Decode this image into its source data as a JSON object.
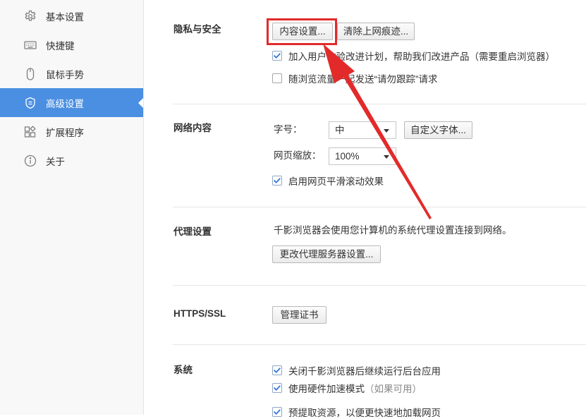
{
  "colors": {
    "accent": "#4a8fe2",
    "annotation": "#e32a2a",
    "check": "#3a7bd5"
  },
  "sidebar": {
    "items": [
      {
        "label": "基本设置",
        "icon": "gear-icon",
        "active": false
      },
      {
        "label": "快捷键",
        "icon": "keyboard-icon",
        "active": false
      },
      {
        "label": "鼠标手势",
        "icon": "mouse-icon",
        "active": false
      },
      {
        "label": "高级设置",
        "icon": "shield-icon",
        "active": true
      },
      {
        "label": "扩展程序",
        "icon": "extensions-icon",
        "active": false
      },
      {
        "label": "关于",
        "icon": "info-icon",
        "active": false
      }
    ]
  },
  "privacy": {
    "title": "隐私与安全",
    "content_settings_button": "内容设置...",
    "clear_history_button": "清除上网痕迹...",
    "checkboxes": [
      {
        "label": "加入用户体验改进计划，帮助我们改进产品（需要重启浏览器）",
        "checked": true
      },
      {
        "label": "随浏览流量一起发送“请勿跟踪”请求",
        "checked": false
      }
    ]
  },
  "web_content": {
    "title": "网络内容",
    "font_size_label": "字号：",
    "font_size_value": "中",
    "custom_fonts_button": "自定义字体...",
    "zoom_label": "网页缩放：",
    "zoom_value": "100%",
    "smooth_scroll": {
      "label": "启用网页平滑滚动效果",
      "checked": true
    }
  },
  "proxy": {
    "title": "代理设置",
    "description": "千影浏览器会使用您计算机的系统代理设置连接到网络。",
    "change_button": "更改代理服务器设置..."
  },
  "https": {
    "title": "HTTPS/SSL",
    "manage_certs_button": "管理证书"
  },
  "system": {
    "title": "系统",
    "checkboxes": [
      {
        "label": "关闭千影浏览器后继续运行后台应用",
        "checked": true
      },
      {
        "label": "使用硬件加速模式",
        "note": "（如果可用）",
        "checked": true
      },
      {
        "label": "预提取资源，以便更快速地加载网页",
        "checked": true
      }
    ]
  }
}
